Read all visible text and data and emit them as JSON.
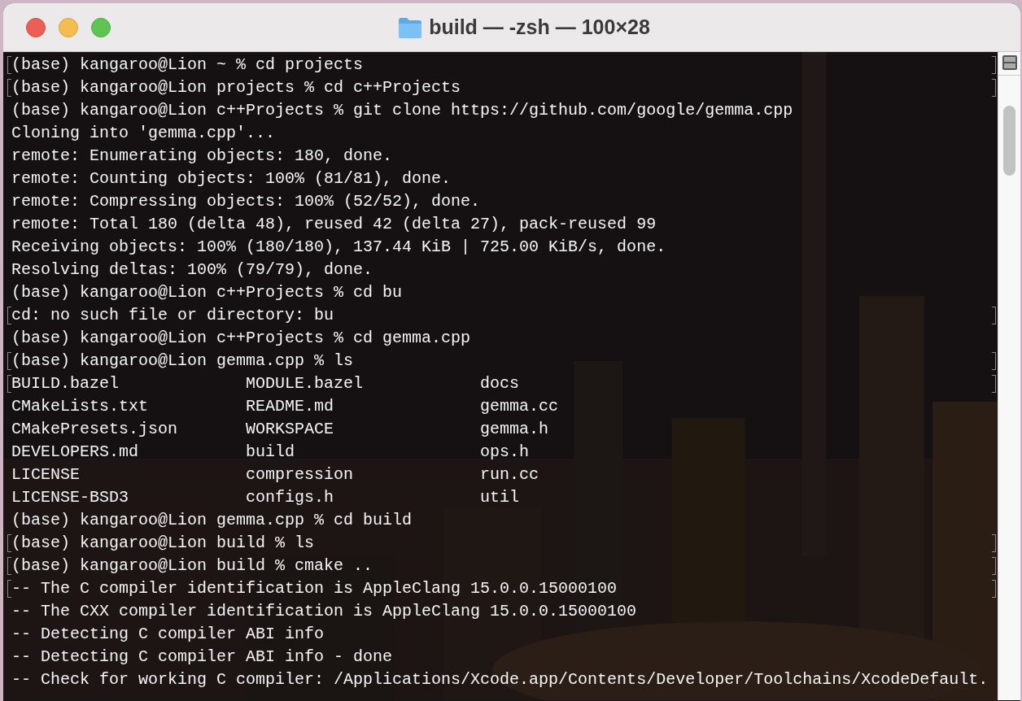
{
  "window": {
    "title": "build — -zsh — 100×28"
  },
  "terminal": {
    "lines": [
      {
        "kind": "text",
        "text": "(base) kangaroo@Lion ~ % cd projects",
        "marked": true
      },
      {
        "kind": "text",
        "text": "(base) kangaroo@Lion projects % cd c++Projects",
        "marked": true
      },
      {
        "kind": "text",
        "text": "(base) kangaroo@Lion c++Projects % git clone https://github.com/google/gemma.cpp",
        "marked": false
      },
      {
        "kind": "text",
        "text": "Cloning into 'gemma.cpp'...",
        "marked": false
      },
      {
        "kind": "text",
        "text": "remote: Enumerating objects: 180, done.",
        "marked": false
      },
      {
        "kind": "text",
        "text": "remote: Counting objects: 100% (81/81), done.",
        "marked": false
      },
      {
        "kind": "text",
        "text": "remote: Compressing objects: 100% (52/52), done.",
        "marked": false
      },
      {
        "kind": "text",
        "text": "remote: Total 180 (delta 48), reused 42 (delta 27), pack-reused 99",
        "marked": false
      },
      {
        "kind": "text",
        "text": "Receiving objects: 100% (180/180), 137.44 KiB | 725.00 KiB/s, done.",
        "marked": false
      },
      {
        "kind": "text",
        "text": "Resolving deltas: 100% (79/79), done.",
        "marked": false
      },
      {
        "kind": "text",
        "text": "(base) kangaroo@Lion c++Projects % cd bu",
        "marked": false
      },
      {
        "kind": "text",
        "text": "cd: no such file or directory: bu",
        "marked": true
      },
      {
        "kind": "text",
        "text": "(base) kangaroo@Lion c++Projects % cd gemma.cpp",
        "marked": false
      },
      {
        "kind": "text",
        "text": "(base) kangaroo@Lion gemma.cpp % ls",
        "marked": true
      },
      {
        "kind": "columns",
        "cells": [
          "BUILD.bazel",
          "MODULE.bazel",
          "docs"
        ],
        "marked": true
      },
      {
        "kind": "columns",
        "cells": [
          "CMakeLists.txt",
          "README.md",
          "gemma.cc"
        ],
        "marked": false
      },
      {
        "kind": "columns",
        "cells": [
          "CMakePresets.json",
          "WORKSPACE",
          "gemma.h"
        ],
        "marked": false
      },
      {
        "kind": "columns",
        "cells": [
          "DEVELOPERS.md",
          "build",
          "ops.h"
        ],
        "marked": false
      },
      {
        "kind": "columns",
        "cells": [
          "LICENSE",
          "compression",
          "run.cc"
        ],
        "marked": false
      },
      {
        "kind": "columns",
        "cells": [
          "LICENSE-BSD3",
          "configs.h",
          "util"
        ],
        "marked": false
      },
      {
        "kind": "text",
        "text": "(base) kangaroo@Lion gemma.cpp % cd build",
        "marked": false
      },
      {
        "kind": "text",
        "text": "(base) kangaroo@Lion build % ls",
        "marked": true
      },
      {
        "kind": "text",
        "text": "(base) kangaroo@Lion build % cmake ..",
        "marked": true
      },
      {
        "kind": "text",
        "text": "-- The C compiler identification is AppleClang 15.0.0.15000100",
        "marked": true
      },
      {
        "kind": "text",
        "text": "-- The CXX compiler identification is AppleClang 15.0.0.15000100",
        "marked": false
      },
      {
        "kind": "text",
        "text": "-- Detecting C compiler ABI info",
        "marked": false
      },
      {
        "kind": "text",
        "text": "-- Detecting C compiler ABI info - done",
        "marked": false
      },
      {
        "kind": "text",
        "text": "-- Check for working C compiler: /Applications/Xcode.app/Contents/Developer/Toolchains/XcodeDefault.",
        "marked": false
      }
    ]
  }
}
